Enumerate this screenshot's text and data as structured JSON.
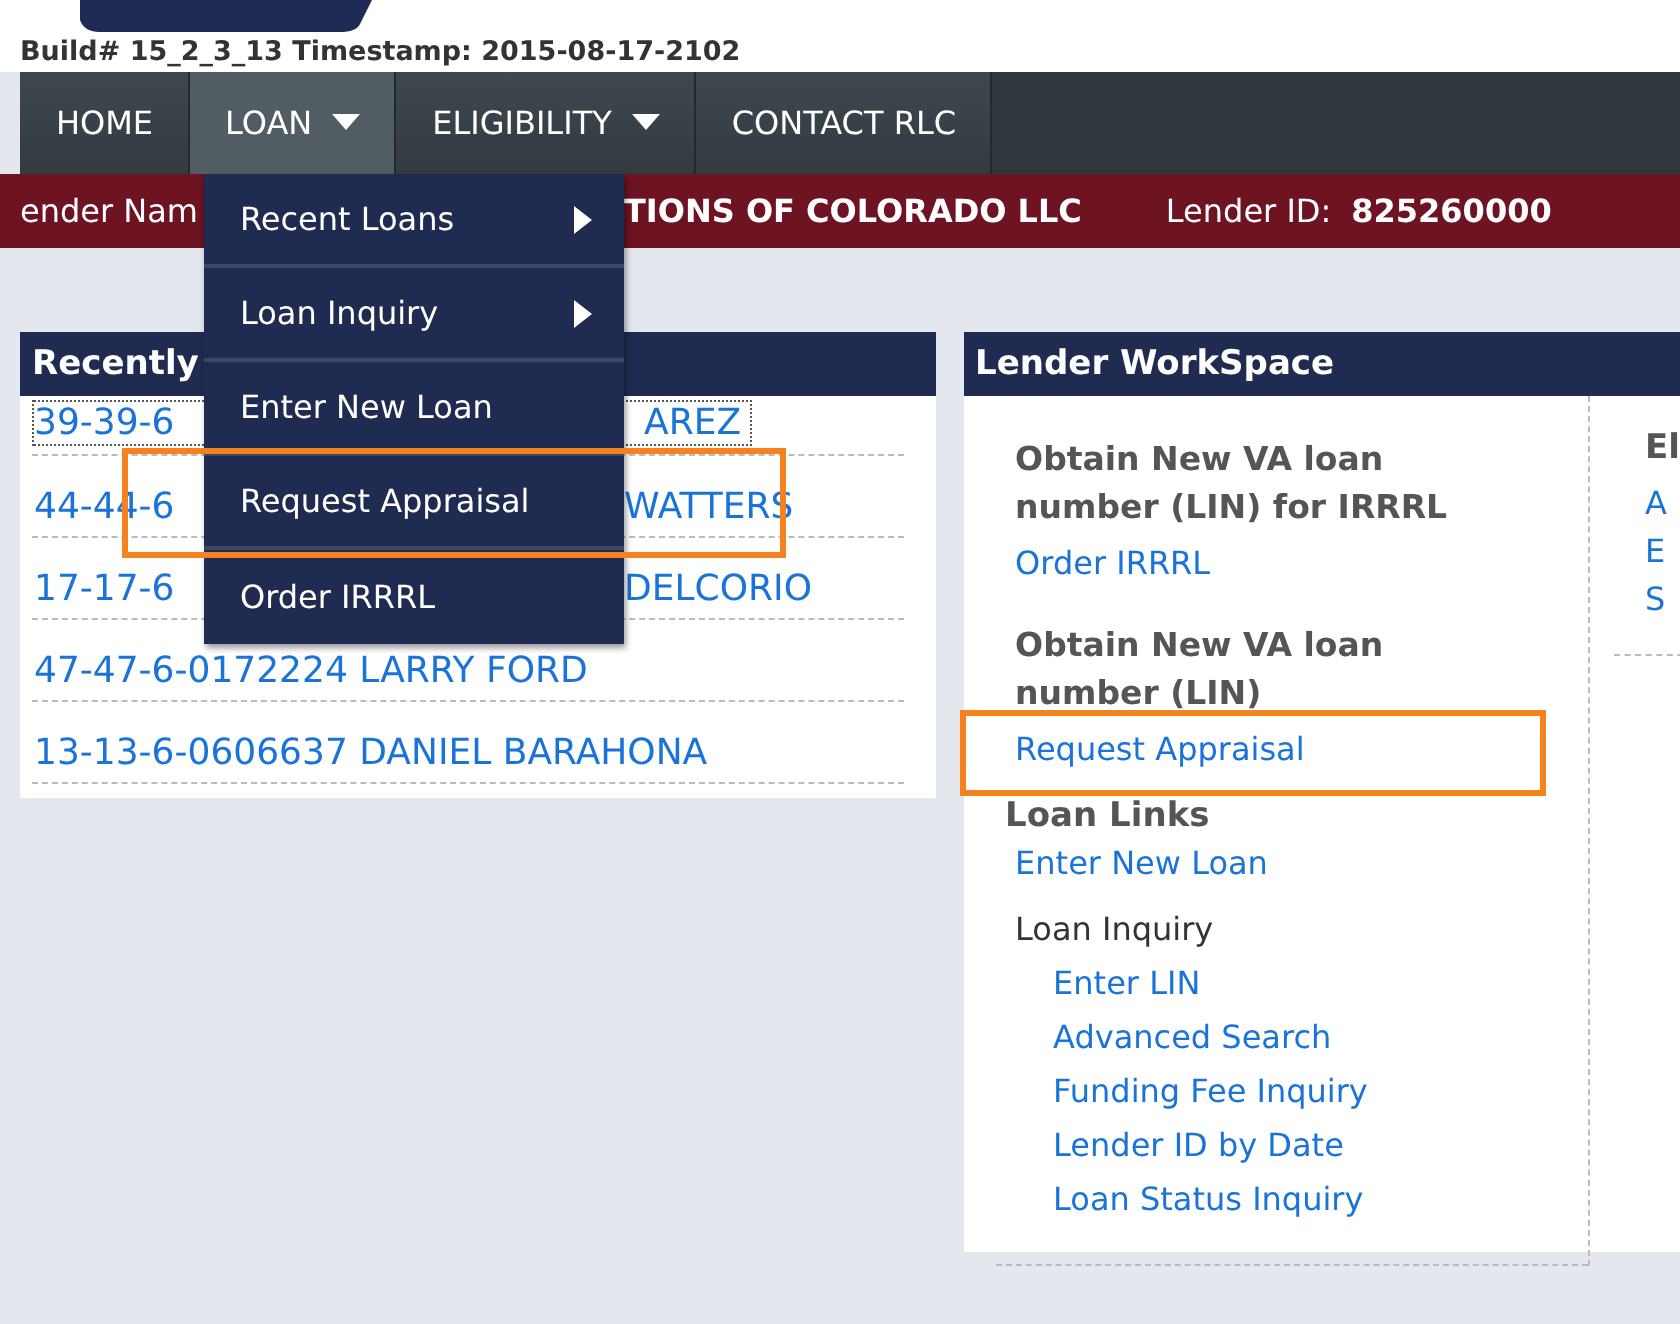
{
  "build_info": "Build# 15_2_3_13 Timestamp: 2015-08-17-2102",
  "nav": [
    {
      "label": "HOME",
      "selected": false,
      "has_menu": false
    },
    {
      "label": "LOAN",
      "selected": true,
      "has_menu": true
    },
    {
      "label": "ELIGIBILITY",
      "selected": false,
      "has_menu": true
    },
    {
      "label": "CONTACT RLC",
      "selected": false,
      "has_menu": false
    }
  ],
  "lender_bar": {
    "name_label": "ender Nam",
    "name_value": "TIONS OF COLORADO LLC",
    "id_label": "Lender ID:",
    "id_value": "825260000"
  },
  "dropdown": [
    {
      "label": "Recent Loans",
      "submenu": true
    },
    {
      "label": "Loan Inquiry",
      "submenu": true
    },
    {
      "label": "Enter New Loan",
      "submenu": false
    },
    {
      "label": "Request Appraisal",
      "submenu": false
    },
    {
      "label": "Order IRRRL",
      "submenu": false
    }
  ],
  "recent_panel": {
    "title": "Recently",
    "loans": [
      {
        "start": "39-39-6",
        "end": "AREZ",
        "focused": true
      },
      {
        "start": "44-44-6",
        "end": "WATTERS",
        "focused": false
      },
      {
        "start": "17-17-6",
        "end": "DELCORIO",
        "focused": false
      },
      {
        "start": "47-47-6-0172224 LARRY FORD",
        "focused": false
      },
      {
        "start": "13-13-6-0606637 DANIEL BARAHONA",
        "focused": false
      }
    ]
  },
  "workspace": {
    "title": "Lender WorkSpace",
    "sections": [
      {
        "heading": "Obtain New VA loan number (LIN) for IRRRL",
        "links": [
          "Order IRRRL"
        ]
      },
      {
        "heading": "Obtain New VA loan number (LIN)",
        "links": [
          "Request Appraisal"
        ]
      }
    ],
    "loan_links": {
      "heading": "Loan Links",
      "items": [
        {
          "label": "Enter New Loan",
          "kind": "link"
        },
        {
          "label": "Loan Inquiry",
          "kind": "text",
          "children": [
            {
              "label": "Enter LIN",
              "kind": "link"
            },
            {
              "label": "Advanced Search",
              "kind": "link"
            },
            {
              "label": "Funding Fee Inquiry",
              "kind": "link"
            },
            {
              "label": "Lender ID by Date",
              "kind": "link"
            },
            {
              "label": "Loan Status Inquiry",
              "kind": "link"
            }
          ]
        }
      ]
    },
    "column_2": {
      "heading": "El",
      "links": [
        "A",
        "E",
        "S"
      ]
    }
  }
}
